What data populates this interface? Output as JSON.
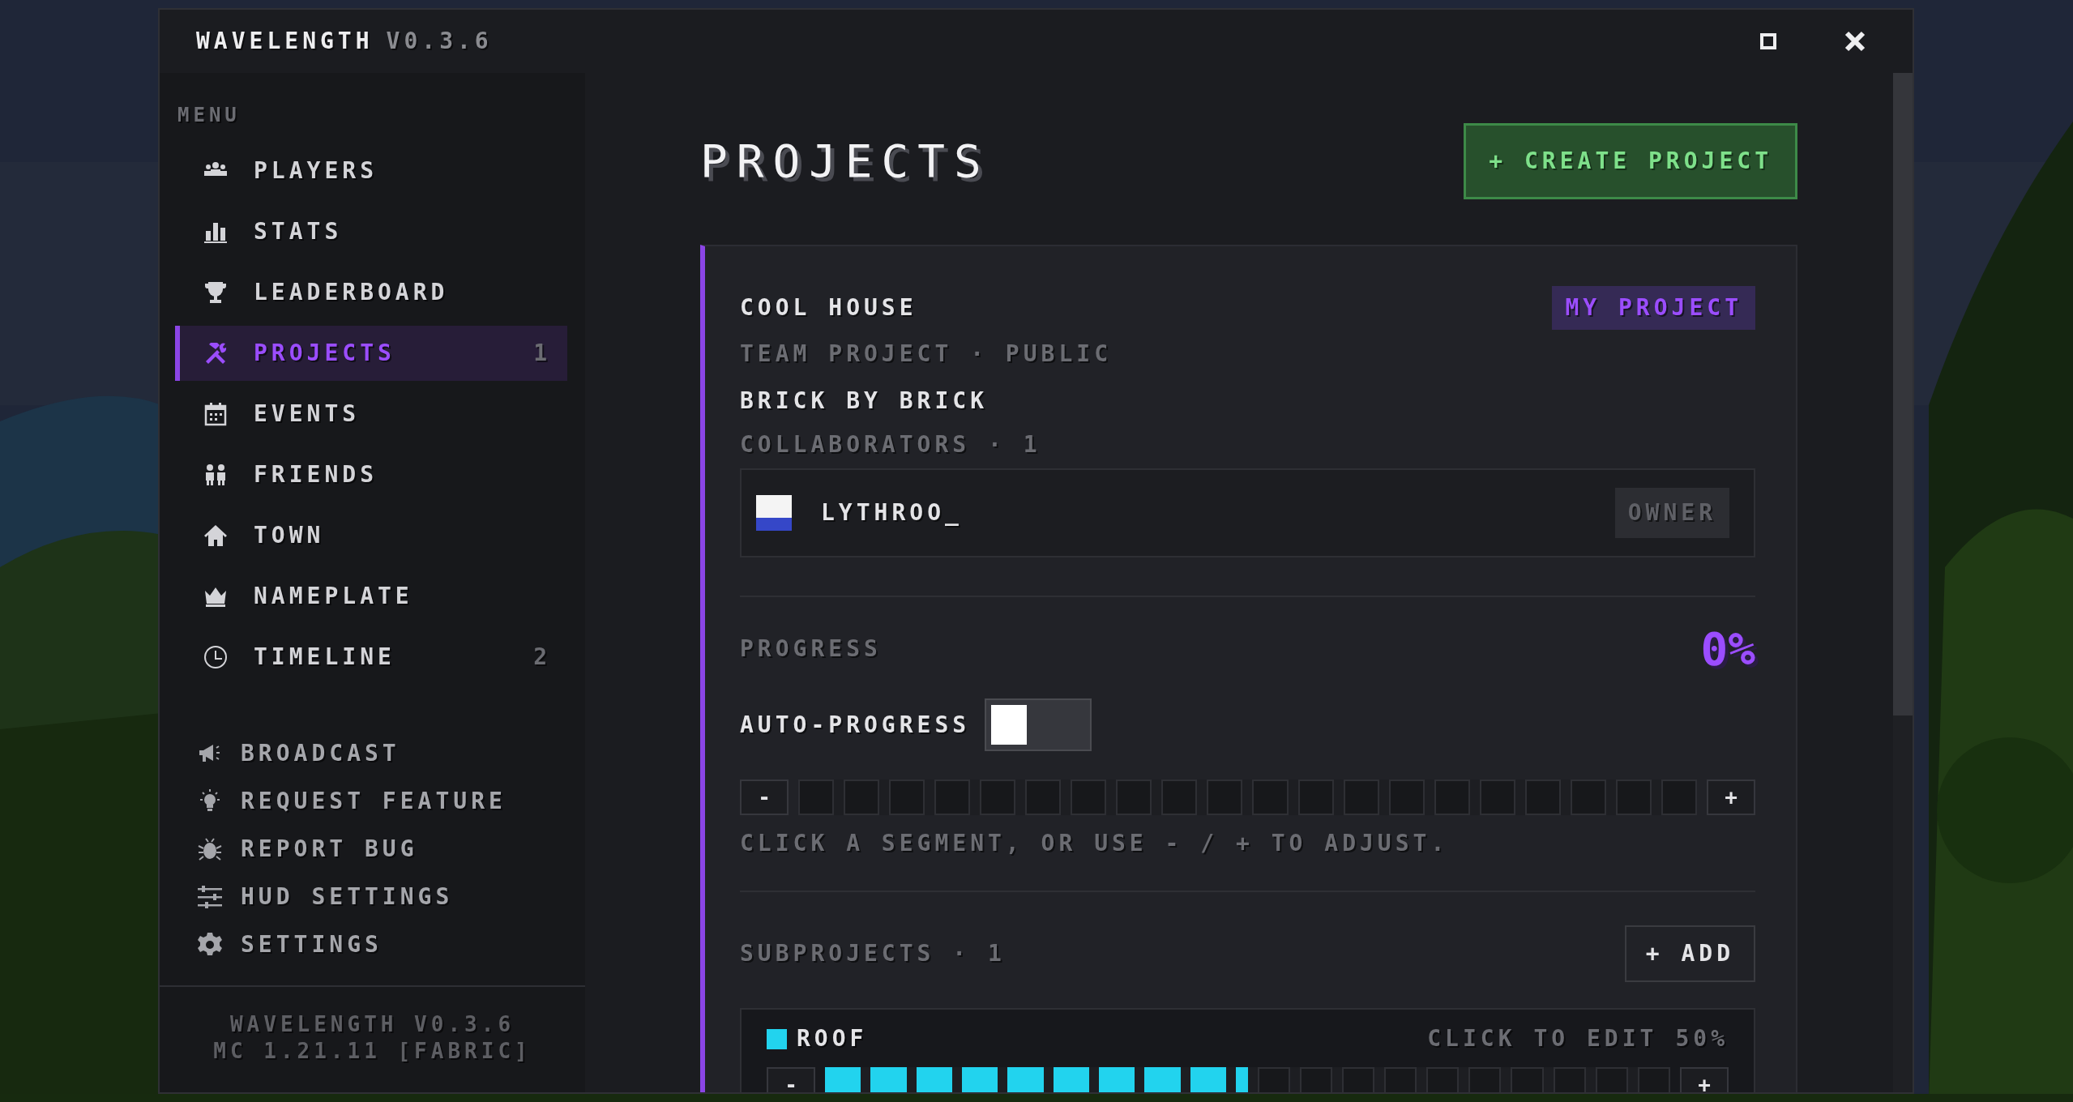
{
  "window": {
    "title": "WAVELENGTH",
    "version": "V0.3.6"
  },
  "sidebar": {
    "heading": "MENU",
    "items": [
      {
        "label": "PLAYERS",
        "selected": false
      },
      {
        "label": "STATS",
        "selected": false
      },
      {
        "label": "LEADERBOARD",
        "selected": false
      },
      {
        "label": "PROJECTS",
        "selected": true,
        "count": "1"
      },
      {
        "label": "EVENTS",
        "selected": false
      },
      {
        "label": "FRIENDS",
        "selected": false
      },
      {
        "label": "TOWN",
        "selected": false
      },
      {
        "label": "NAMEPLATE",
        "selected": false
      },
      {
        "label": "TIMELINE",
        "selected": false,
        "count": "2"
      }
    ],
    "tools": [
      {
        "label": "BROADCAST"
      },
      {
        "label": "REQUEST FEATURE"
      },
      {
        "label": "REPORT BUG"
      },
      {
        "label": "HUD SETTINGS"
      },
      {
        "label": "SETTINGS"
      }
    ],
    "footer": [
      "WAVELENGTH V0.3.6",
      "MC 1.21.11 [FABRIC]"
    ]
  },
  "page": {
    "title": "PROJECTS",
    "create_button": "+ CREATE PROJECT"
  },
  "project": {
    "name": "COOL HOUSE",
    "badge": "MY PROJECT",
    "meta": "TEAM PROJECT · PUBLIC",
    "team_name": "BRICK BY BRICK",
    "collaborators_label": "COLLABORATORS · 1",
    "collaborators": [
      {
        "name": "LYTHROO_",
        "role": "OWNER"
      }
    ],
    "progress_label": "PROGRESS",
    "progress_percent": "0%",
    "auto_progress": {
      "label": "AUTO-PROGRESS",
      "on": false
    },
    "progress": {
      "level": 0,
      "decrement": "-",
      "increment": "+"
    },
    "hint": "CLICK A SEGMENT, OR USE - / + TO ADJUST.",
    "subprojects_label": "SUBPROJECTS · 1",
    "add_button": "+ ADD",
    "subprojects": [
      {
        "name": "ROOF",
        "color": "#22d3ee",
        "edit_hint": "CLICK TO EDIT",
        "percent": "50%",
        "level": 0.5,
        "decrement": "-",
        "increment": "+"
      }
    ]
  }
}
